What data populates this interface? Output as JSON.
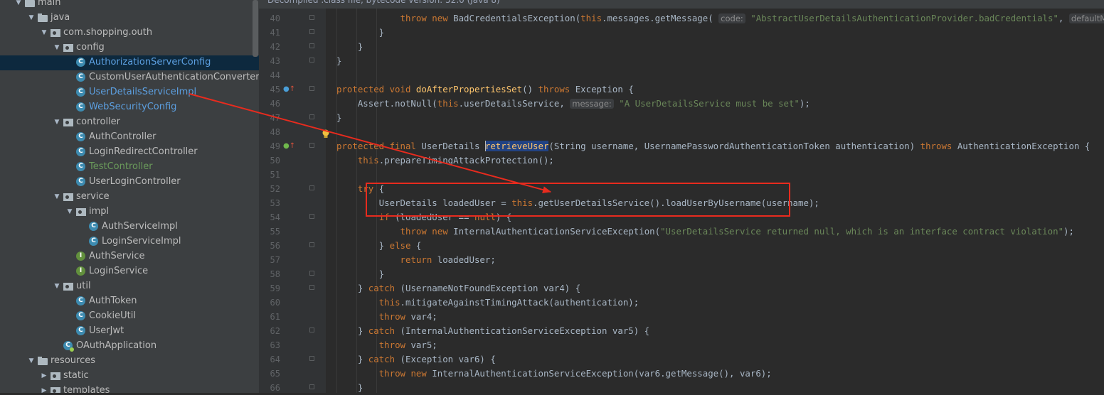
{
  "editor_header": "Decompiled .class file, bytecode version: 52.0 (Java 8)",
  "tree": {
    "items": [
      {
        "label": "main",
        "type": "folder",
        "indent": 0,
        "expanded": true,
        "color": ""
      },
      {
        "label": "java",
        "type": "srcfolder",
        "indent": 1,
        "expanded": true,
        "color": ""
      },
      {
        "label": "com.shopping.outh",
        "type": "package",
        "indent": 2,
        "expanded": true,
        "color": ""
      },
      {
        "label": "config",
        "type": "package",
        "indent": 3,
        "expanded": true,
        "color": ""
      },
      {
        "label": "AuthorizationServerConfig",
        "type": "class",
        "indent": 4,
        "color": "blue",
        "selected": true
      },
      {
        "label": "CustomUserAuthenticationConverter",
        "type": "class",
        "indent": 4,
        "color": ""
      },
      {
        "label": "UserDetailsServiceImpl",
        "type": "class",
        "indent": 4,
        "color": "blue"
      },
      {
        "label": "WebSecurityConfig",
        "type": "class",
        "indent": 4,
        "color": "blue"
      },
      {
        "label": "controller",
        "type": "package",
        "indent": 3,
        "expanded": true,
        "color": ""
      },
      {
        "label": "AuthController",
        "type": "class",
        "indent": 4,
        "color": ""
      },
      {
        "label": "LoginRedirectController",
        "type": "class",
        "indent": 4,
        "color": ""
      },
      {
        "label": "TestController",
        "type": "class",
        "indent": 4,
        "color": "green"
      },
      {
        "label": "UserLoginController",
        "type": "class",
        "indent": 4,
        "color": ""
      },
      {
        "label": "service",
        "type": "package",
        "indent": 3,
        "expanded": true,
        "color": ""
      },
      {
        "label": "impl",
        "type": "package",
        "indent": 4,
        "expanded": true,
        "color": ""
      },
      {
        "label": "AuthServiceImpl",
        "type": "class",
        "indent": 5,
        "color": ""
      },
      {
        "label": "LoginServiceImpl",
        "type": "class",
        "indent": 5,
        "color": ""
      },
      {
        "label": "AuthService",
        "type": "interface",
        "indent": 4,
        "color": ""
      },
      {
        "label": "LoginService",
        "type": "interface",
        "indent": 4,
        "color": ""
      },
      {
        "label": "util",
        "type": "package",
        "indent": 3,
        "expanded": true,
        "color": ""
      },
      {
        "label": "AuthToken",
        "type": "class",
        "indent": 4,
        "color": ""
      },
      {
        "label": "CookieUtil",
        "type": "class",
        "indent": 4,
        "color": ""
      },
      {
        "label": "UserJwt",
        "type": "class",
        "indent": 4,
        "color": ""
      },
      {
        "label": "OAuthApplication",
        "type": "app",
        "indent": 3,
        "color": ""
      },
      {
        "label": "resources",
        "type": "resfolder",
        "indent": 1,
        "expanded": true,
        "color": ""
      },
      {
        "label": "static",
        "type": "package",
        "indent": 2,
        "expanded": false,
        "color": ""
      },
      {
        "label": "templates",
        "type": "package",
        "indent": 2,
        "expanded": false,
        "color": ""
      }
    ]
  },
  "code": {
    "lines": [
      {
        "n": "40",
        "html": "            <span class=\"kw\">throw new </span>BadCredentialsException(<span class=\"kw\">this</span>.messages.getMessage( <span class=\"hint\">code:</span> <span class=\"str\">\"AbstractUserDetailsAuthenticationProvider.badCredentials\"</span>, <span class=\"hint\">defaultMessage:</span> <span class=\"str\">\"</span>",
        "fold": true
      },
      {
        "n": "41",
        "html": "        }",
        "fold": true
      },
      {
        "n": "42",
        "html": "    }",
        "fold": true
      },
      {
        "n": "43",
        "html": "}",
        "fold": true
      },
      {
        "n": "44",
        "html": ""
      },
      {
        "n": "45",
        "html": "<span class=\"kw\">protected void </span><span class=\"mth\">doAfterPropertiesSet</span>() <span class=\"kw\">throws </span>Exception {",
        "fold": true,
        "mark": "override"
      },
      {
        "n": "46",
        "html": "    Assert.notNull(<span class=\"kw\">this</span>.userDetailsService, <span class=\"hint\">message:</span> <span class=\"str\">\"A UserDetailsService must be set\"</span>);"
      },
      {
        "n": "47",
        "html": "}",
        "fold": true
      },
      {
        "n": "48",
        "html": ""
      },
      {
        "n": "49",
        "html": "<span class=\"kw\">protected final </span>UserDetails <span class=\"sel\"><span class=\"mth\">retrieveUser</span></span>(String username, UsernamePasswordAuthenticationToken authentication) <span class=\"kw\">throws </span>AuthenticationException {",
        "fold": true,
        "mark": "implement"
      },
      {
        "n": "50",
        "html": "    <span class=\"kw\">this</span>.prepareTimingAttackProtection();"
      },
      {
        "n": "51",
        "html": ""
      },
      {
        "n": "52",
        "html": "    <span class=\"kw\">try </span>{",
        "fold": true
      },
      {
        "n": "53",
        "html": "        UserDetails loadedUser = <span class=\"kw\">this</span>.getUserDetailsService().loadUserByUsername(username);"
      },
      {
        "n": "54",
        "html": "        <span class=\"kw\">if </span>(loadedUser == <span class=\"kw\">null</span>) {",
        "fold": true
      },
      {
        "n": "55",
        "html": "            <span class=\"kw\">throw new </span>InternalAuthenticationServiceException(<span class=\"str\">\"UserDetailsService returned null, which is an interface contract violation\"</span>);"
      },
      {
        "n": "56",
        "html": "        } <span class=\"kw\">else </span>{",
        "fold": true
      },
      {
        "n": "57",
        "html": "            <span class=\"kw\">return </span>loadedUser;"
      },
      {
        "n": "58",
        "html": "        }",
        "fold": true
      },
      {
        "n": "59",
        "html": "    } <span class=\"kw\">catch </span>(UsernameNotFoundException var4) {",
        "fold": true
      },
      {
        "n": "60",
        "html": "        <span class=\"kw\">this</span>.mitigateAgainstTimingAttack(authentication);"
      },
      {
        "n": "61",
        "html": "        <span class=\"kw\">throw </span>var4;"
      },
      {
        "n": "62",
        "html": "    } <span class=\"kw\">catch </span>(InternalAuthenticationServiceException var5) {",
        "fold": true
      },
      {
        "n": "63",
        "html": "        <span class=\"kw\">throw </span>var5;"
      },
      {
        "n": "64",
        "html": "    } <span class=\"kw\">catch </span>(Exception var6) {",
        "fold": true
      },
      {
        "n": "65",
        "html": "        <span class=\"kw\">throw new </span>InternalAuthenticationServiceException(var6.getMessage(), var6);"
      },
      {
        "n": "66",
        "html": "    }",
        "fold": true
      }
    ]
  },
  "colors": {
    "annotation": "#e82b1e",
    "keyword": "#cc7832",
    "string": "#6a8759",
    "method": "#ffc66d"
  }
}
